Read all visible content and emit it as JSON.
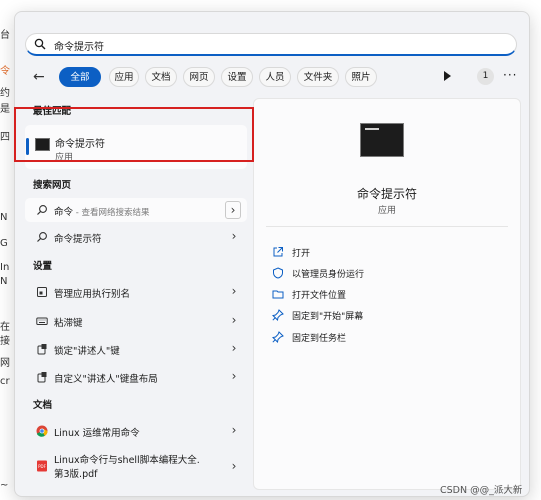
{
  "search": {
    "query": "命令提示符"
  },
  "filters": {
    "back": "←",
    "chips": [
      "全部",
      "应用",
      "文档",
      "网页",
      "设置",
      "人员",
      "文件夹",
      "照片"
    ],
    "badge": "1",
    "more": "···"
  },
  "best_match": {
    "section_label": "最佳匹配",
    "title": "命令提示符",
    "subtitle": "应用"
  },
  "web": {
    "section_label": "搜索网页",
    "items": [
      {
        "label": "命令",
        "sub": " - 查看网络搜索结果"
      },
      {
        "label": "命令提示符",
        "sub": ""
      }
    ]
  },
  "settings": {
    "section_label": "设置",
    "items": [
      "管理应用执行别名",
      "粘滞键",
      "锁定\"讲述人\"键",
      "自定义\"讲述人\"键盘布局"
    ]
  },
  "docs": {
    "section_label": "文档",
    "items": [
      "Linux 运维常用命令",
      "Linux命令行与shell脚本编程大全.",
      "第3版.pdf"
    ]
  },
  "preview": {
    "title": "命令提示符",
    "subtitle": "应用",
    "actions": [
      "打开",
      "以管理员身份运行",
      "打开文件位置",
      "固定到\"开始\"屏幕",
      "固定到任务栏"
    ]
  },
  "background": {
    "left_chars": [
      "台",
      "令",
      "约",
      "是",
      "四",
      "N",
      "G",
      "In",
      "N",
      "在",
      "接",
      "网",
      "cr"
    ],
    "bottom": "~"
  },
  "watermark": "CSDN @@_派大新",
  "colors": {
    "accent": "#0c5fc4",
    "highlight_box": "#d6201f",
    "panel_bg": "#f2f3f6"
  },
  "icons": {
    "search": "search-icon",
    "back": "back-arrow-icon",
    "play": "play-icon",
    "cmd": "command-prompt-icon",
    "web": "web-search-icon",
    "settings_app": "app-alias-icon",
    "keyboard": "keyboard-icon",
    "narrator": "narrator-icon",
    "chrome": "chrome-icon",
    "pdf": "pdf-icon",
    "open": "open-icon",
    "admin": "run-as-admin-icon",
    "folder": "folder-icon",
    "pin": "pin-icon"
  }
}
